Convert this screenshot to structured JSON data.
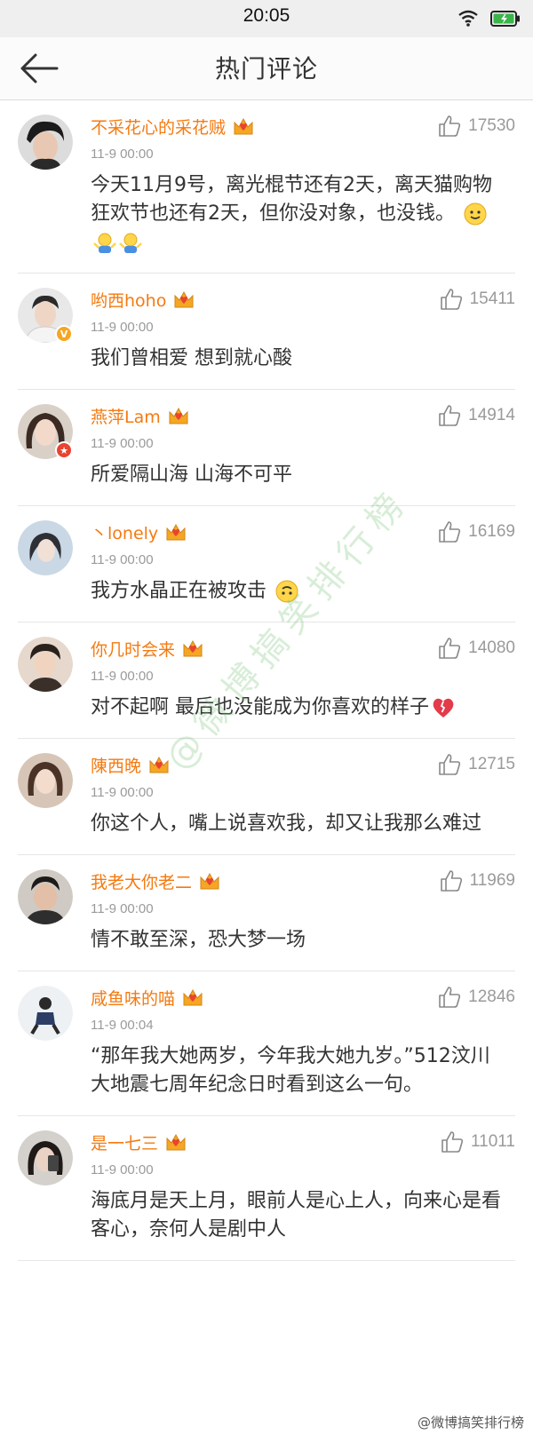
{
  "status_bar": {
    "time": "20:05"
  },
  "navbar": {
    "title": "热门评论"
  },
  "comments": [
    {
      "username": "不采花心的采花贼",
      "time": "11-9 00:00",
      "likes": "17530",
      "text": "今天11月9号，离光棍节还有2天，离天猫购物狂欢节也还有2天，但你没对象，也没钱。",
      "emojis": [
        "smile-emoji",
        "shrug-emoji",
        "shrug-emoji"
      ]
    },
    {
      "username": "哟西hoho",
      "time": "11-9 00:00",
      "likes": "15411",
      "text": "我们曾相爱 想到就心酸",
      "badge": "gold-v"
    },
    {
      "username": "燕萍Lam",
      "time": "11-9 00:00",
      "likes": "14914",
      "text": "所爱隔山海 山海不可平",
      "badge": "red-star"
    },
    {
      "username": "丶lonely",
      "time": "11-9 00:00",
      "likes": "16169",
      "text": "我方水晶正在被攻击",
      "emojis": [
        "upside-down-face-emoji"
      ]
    },
    {
      "username": "你几时会来",
      "time": "11-9 00:00",
      "likes": "14080",
      "text": "对不起啊 最后也没能成为你喜欢的样子",
      "emojis": [
        "broken-heart-emoji"
      ]
    },
    {
      "username": "陳西晚",
      "time": "11-9 00:00",
      "likes": "12715",
      "text": "你这个人，嘴上说喜欢我，却又让我那么难过"
    },
    {
      "username": "我老大你老二",
      "time": "11-9 00:00",
      "likes": "11969",
      "text": "情不敢至深，恐大梦一场"
    },
    {
      "username": "咸鱼味的喵",
      "time": "11-9 00:04",
      "likes": "12846",
      "text": "“那年我大她两岁，今年我大她九岁。”512汶川大地震七周年纪念日时看到这么一句。"
    },
    {
      "username": "是一七三",
      "time": "11-9 00:00",
      "likes": "11011",
      "text": "海底月是天上月，眼前人是心上人，向来心是看客心，奈何人是剧中人"
    }
  ],
  "watermark": "@微博搞笑排行榜",
  "corner_mark": "@微博搞笑排行榜",
  "colors": {
    "username": "#f57a10",
    "meta": "#9a9a9a",
    "text": "#333333"
  }
}
